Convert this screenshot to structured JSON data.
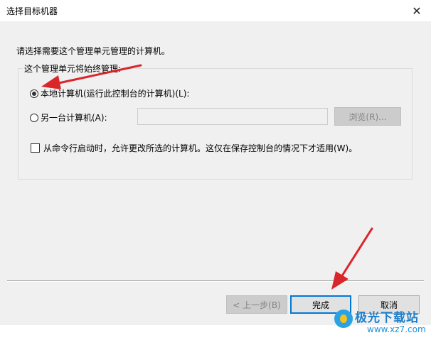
{
  "window": {
    "title": "选择目标机器",
    "close_glyph": "✕"
  },
  "prompt": "请选择需要这个管理单元管理的计算机。",
  "group": {
    "legend": "这个管理单元将始终管理:",
    "local_option": {
      "label": "本地计算机(运行此控制台的计算机)(L):",
      "checked": true
    },
    "other_option": {
      "label": "另一台计算机(A):",
      "checked": false
    },
    "other_input_value": "",
    "browse_label": "浏览(R)...",
    "allow_change_checkbox": {
      "label": "从命令行启动时，允许更改所选的计算机。这仅在保存控制台的情况下才适用(W)。",
      "checked": false
    }
  },
  "buttons": {
    "back": "< 上一步(B)",
    "finish": "完成",
    "cancel": "取消"
  },
  "watermark": {
    "brand": "极光下载站",
    "url": "www.xz7.com"
  },
  "colors": {
    "annotation_arrow": "#d9262b",
    "focus_border": "#0078d7",
    "client_bg": "#f0f0f0"
  }
}
